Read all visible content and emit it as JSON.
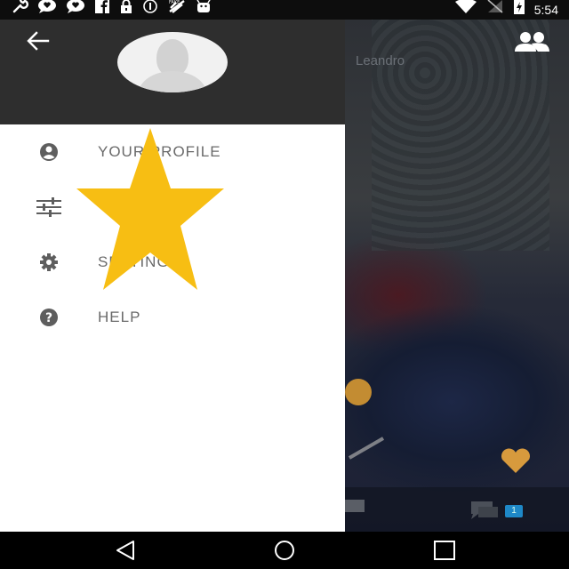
{
  "status_bar": {
    "time": "5:54",
    "left_icons": [
      "wrench-icon",
      "chat-heart-icon",
      "chat-heart-icon",
      "facebook-icon",
      "lock-icon",
      "info-circle-icon",
      "satellite-icon",
      "android-icon"
    ],
    "right_icons": [
      "wifi-icon",
      "signal-off-icon",
      "battery-charging-icon"
    ]
  },
  "drawer": {
    "menu": [
      {
        "id": "profile",
        "label": "YOUR PROFILE",
        "icon": "account-circle-icon"
      },
      {
        "id": "filters",
        "label": "",
        "icon": "sliders-icon"
      },
      {
        "id": "settings",
        "label": "SETTINGS",
        "icon": "gear-icon"
      },
      {
        "id": "help",
        "label": "HELP",
        "icon": "help-circle-icon"
      }
    ]
  },
  "video": {
    "user_name": "Leandro",
    "chat_badge": "1"
  },
  "overlay": {
    "star_color": "#F7BE13"
  },
  "colors": {
    "drawer_header": "#2e2e2e",
    "menu_text": "#6a6a6a",
    "icon": "#5e5e5e"
  },
  "nav_bar": {
    "buttons": [
      "back-triangle-icon",
      "home-circle-icon",
      "recents-square-icon"
    ]
  }
}
